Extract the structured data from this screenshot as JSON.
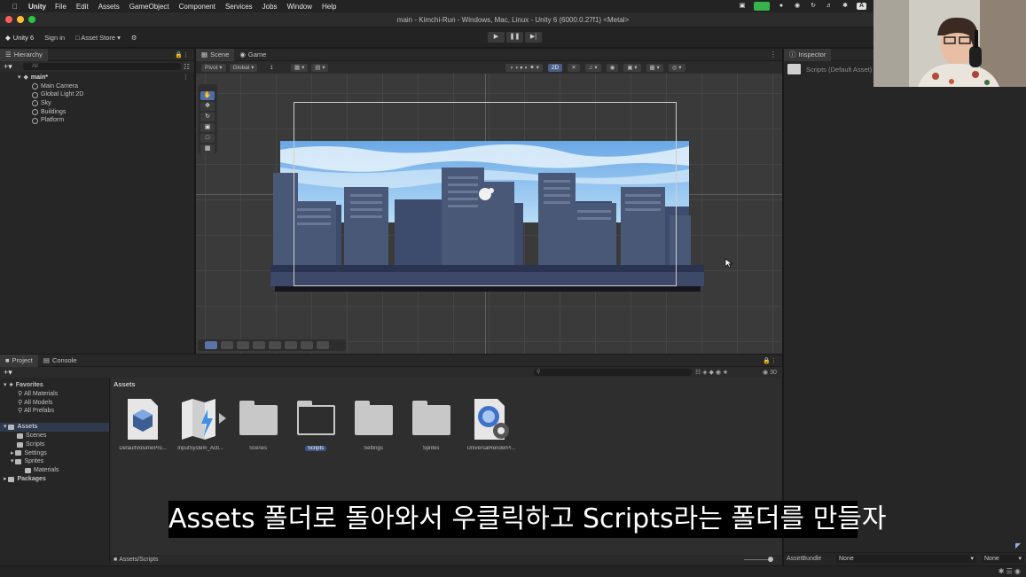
{
  "menubar": {
    "app": "Unity",
    "items": [
      "File",
      "Edit",
      "Assets",
      "GameObject",
      "Component",
      "Services",
      "Jobs",
      "Window",
      "Help"
    ],
    "status_letter": "A"
  },
  "window": {
    "title": "main - Kimchi-Run - Windows, Mac, Linux - Unity 6 (6000.0.27f1) <Metal>"
  },
  "toolbar": {
    "account": "Unity 6",
    "sign_in": "Sign in",
    "asset_store": "Asset Store"
  },
  "hierarchy": {
    "tab": "Hierarchy",
    "search_placeholder": "All",
    "scene": "main*",
    "items": [
      "Main Camera",
      "Global Light 2D",
      "Sky",
      "Buildings",
      "Platform"
    ]
  },
  "scene_view": {
    "tabs": [
      "Scene",
      "Game"
    ],
    "pivot": "Pivot",
    "global": "Global",
    "grid_value": "1",
    "mode_2d": "2D"
  },
  "inspector": {
    "tab": "Inspector",
    "selected": "Scripts (Default Asset)",
    "asset_bundle_label": "AssetBundle",
    "asset_bundle_value": "None",
    "variant_value": "None"
  },
  "project": {
    "tabs": [
      "Project",
      "Console"
    ],
    "favorites": {
      "label": "Favorites",
      "items": [
        "All Materials",
        "All Models",
        "All Prefabs"
      ]
    },
    "assets_tree": {
      "label": "Assets",
      "items": [
        "Scenes",
        "Scripts",
        "Settings",
        "Sprites"
      ],
      "sprites_child": "Materials"
    },
    "packages": "Packages",
    "breadcrumb": "Assets",
    "count": "30",
    "assets": [
      {
        "name": "DefaultVolumePro..."
      },
      {
        "name": "InputSystem_Acti..."
      },
      {
        "name": "Scenes"
      },
      {
        "name": "Scripts"
      },
      {
        "name": "Settings"
      },
      {
        "name": "Sprites"
      },
      {
        "name": "UniversalRenderPi..."
      }
    ],
    "footer_path": "Assets/Scripts"
  },
  "subtitle": "Assets 폴더로 돌아와서 우클릭하고 Scripts라는 폴더를 만들자"
}
